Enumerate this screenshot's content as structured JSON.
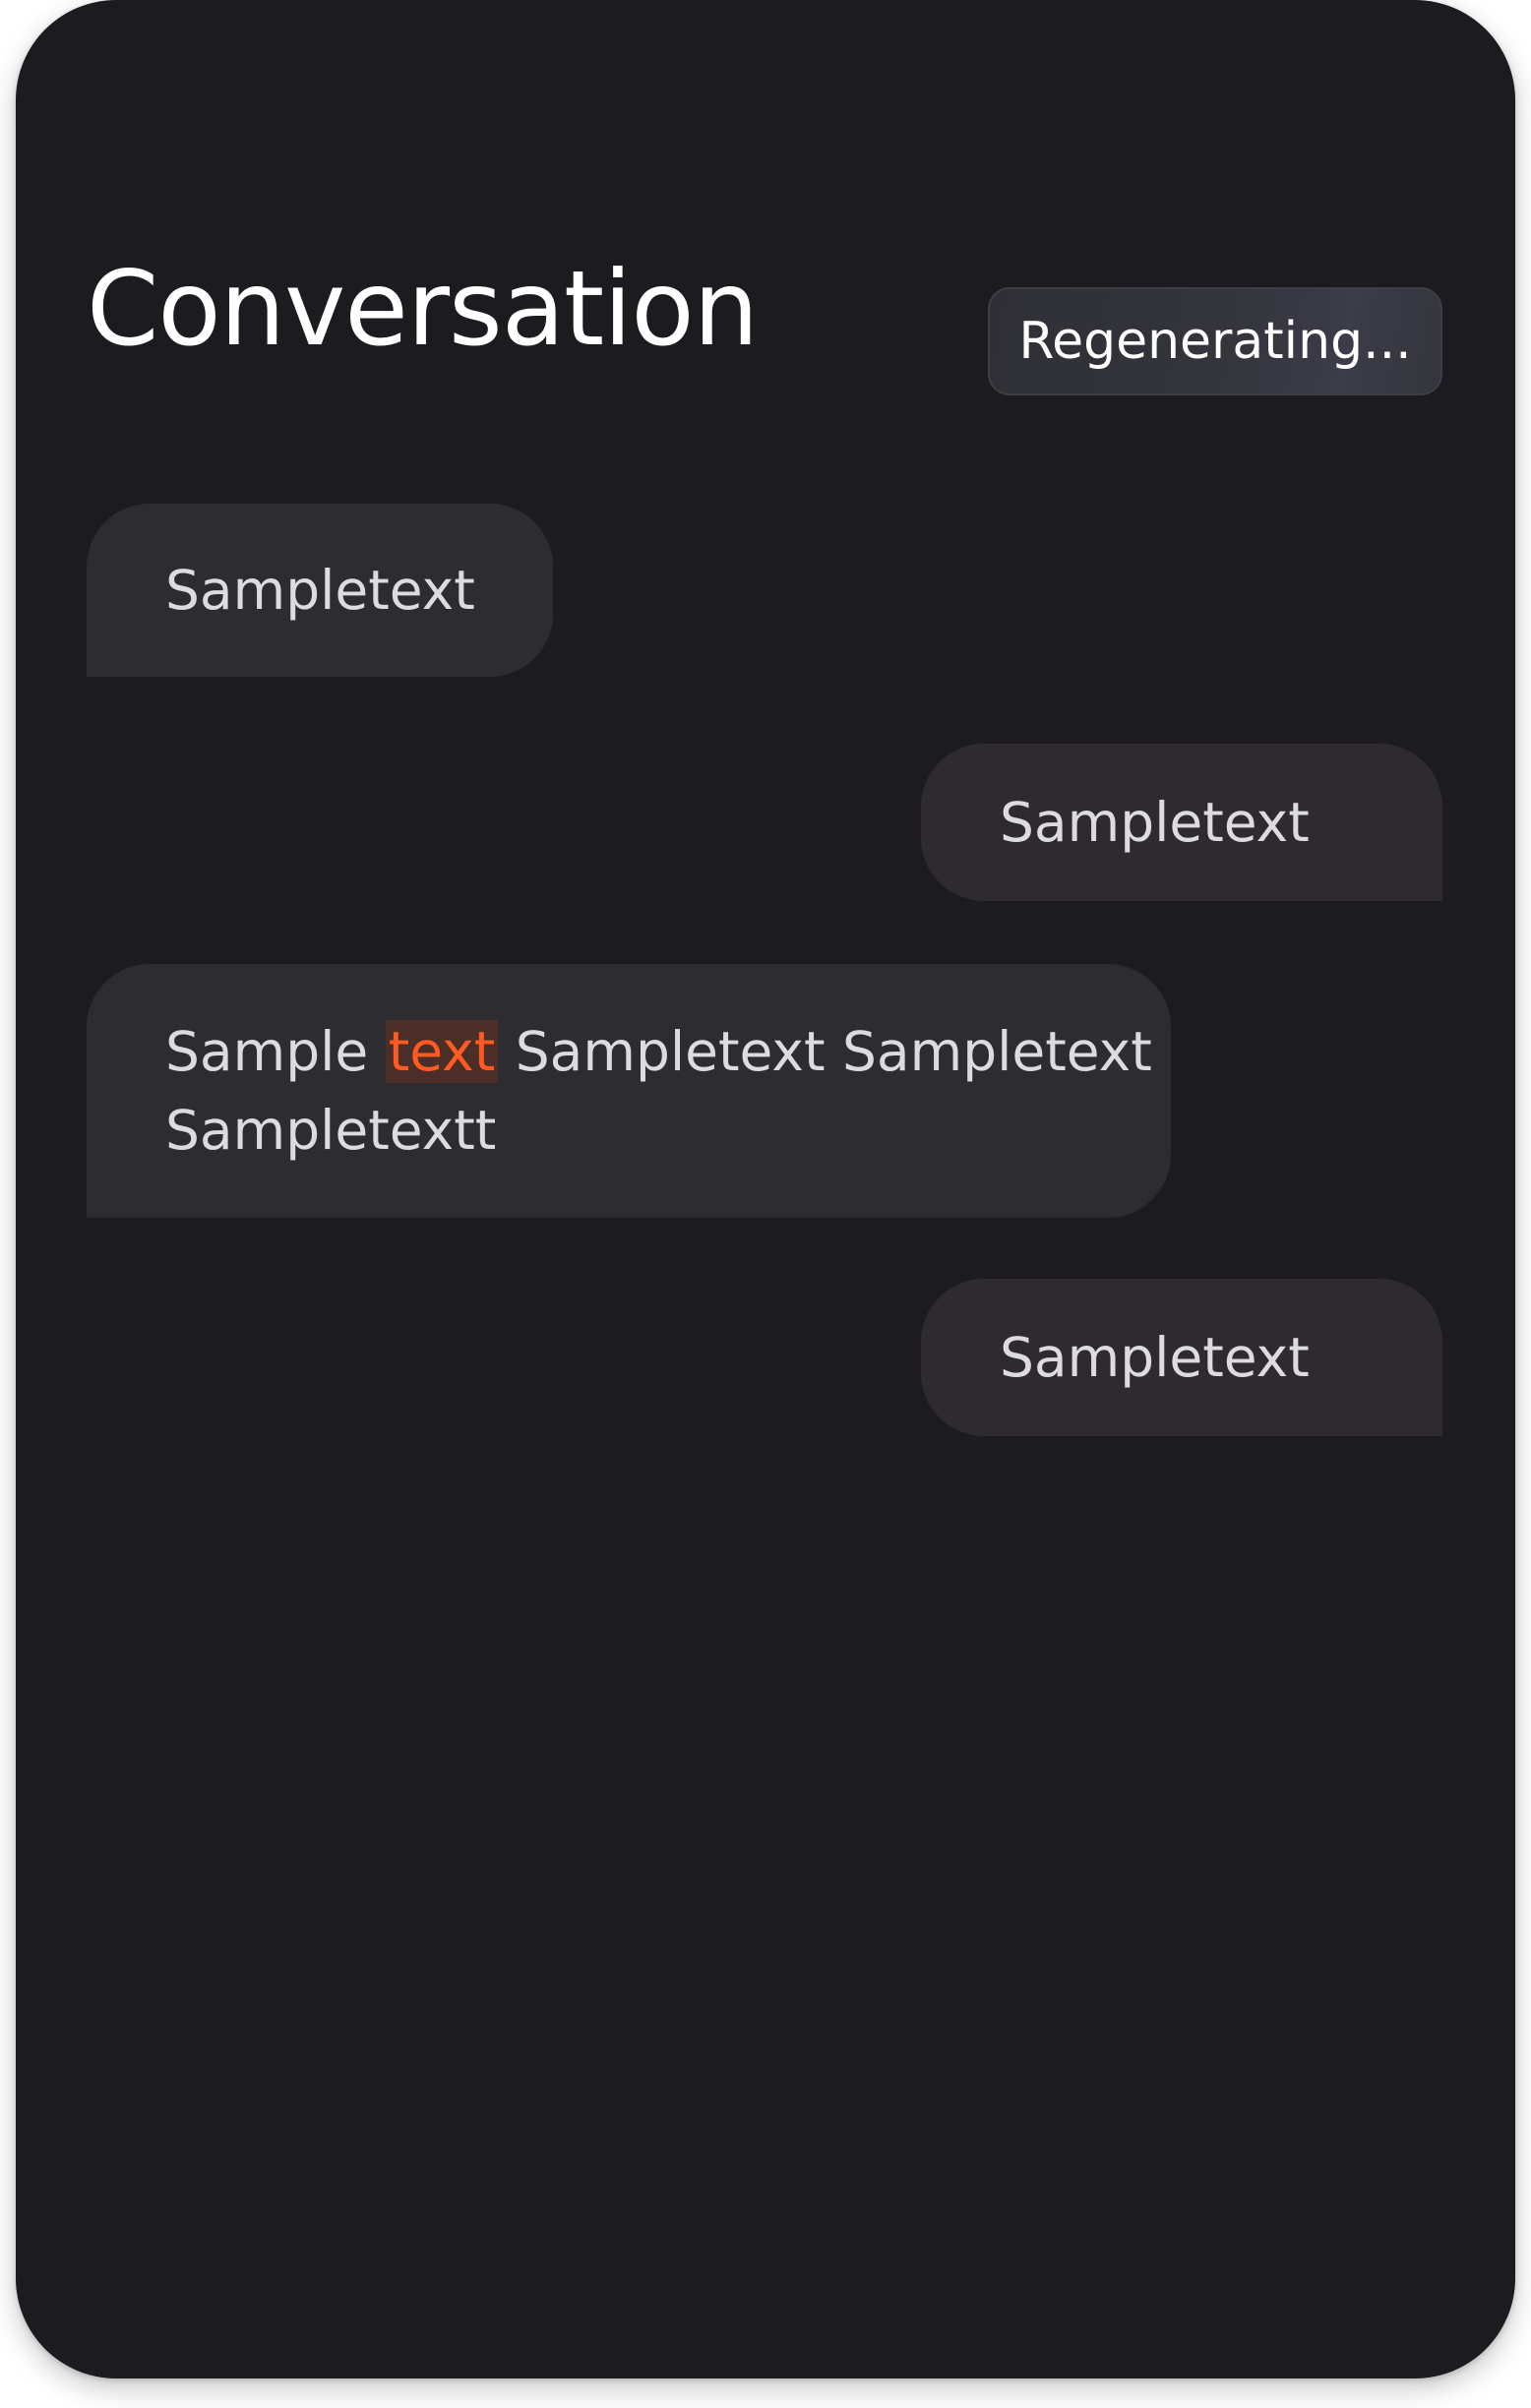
{
  "header": {
    "title": "Conversation",
    "regenerate_label": "Regenerating..."
  },
  "messages": [
    {
      "role": "incoming",
      "text": "Sampletext"
    },
    {
      "role": "outgoing",
      "text": "Sampletext"
    },
    {
      "role": "incoming",
      "line1_prefix": "Sample ",
      "highlight": "text",
      "line1_suffix": " Sampletext Sampletext",
      "line2": "Sampletextt"
    },
    {
      "role": "outgoing",
      "text": "Sampletext"
    }
  ],
  "colors": {
    "background": "#1c1c20",
    "incoming_bubble": "#2c2c31",
    "outgoing_bubble": "#2f2930",
    "highlight_text": "#ff5a1f",
    "highlight_bg": "#4a2e27"
  }
}
